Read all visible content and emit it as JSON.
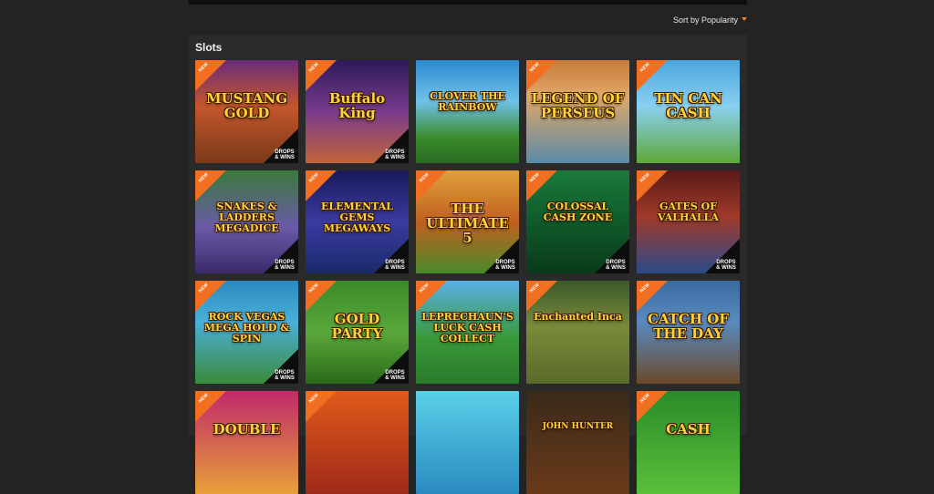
{
  "header": {
    "sort_label": "Sort by Popularity"
  },
  "section": {
    "title": "Slots"
  },
  "badge_new": "NEW",
  "drops_label": "DROPS & WINS",
  "games": [
    {
      "name": "MUSTANG GOLD",
      "drops": true
    },
    {
      "name": "Buffalo King",
      "drops": true
    },
    {
      "name": "CLOVER THE RAINBOW",
      "drops": false
    },
    {
      "name": "LEGEND OF PERSEUS",
      "drops": false
    },
    {
      "name": "TIN CAN CASH",
      "drops": false
    },
    {
      "name": "SNAKES & LADDERS MEGADICE",
      "drops": true
    },
    {
      "name": "ELEMENTAL GEMS MEGAWAYS",
      "drops": true
    },
    {
      "name": "THE ULTIMATE 5",
      "drops": true
    },
    {
      "name": "COLOSSAL CASH ZONE",
      "drops": true
    },
    {
      "name": "GATES OF VALHALLA",
      "drops": true
    },
    {
      "name": "ROCK VEGAS MEGA HOLD & SPIN",
      "drops": true
    },
    {
      "name": "GOLD PARTY",
      "drops": true
    },
    {
      "name": "LEPRECHAUN'S LUCK CASH COLLECT",
      "drops": false
    },
    {
      "name": "Enchanted Inca",
      "drops": false
    },
    {
      "name": "CATCH OF THE DAY",
      "drops": false
    },
    {
      "name": "DOUBLE",
      "drops": false
    },
    {
      "name": "",
      "drops": false
    },
    {
      "name": "",
      "drops": false
    },
    {
      "name": "JOHN HUNTER",
      "drops": false
    },
    {
      "name": "CASH",
      "drops": false
    }
  ]
}
